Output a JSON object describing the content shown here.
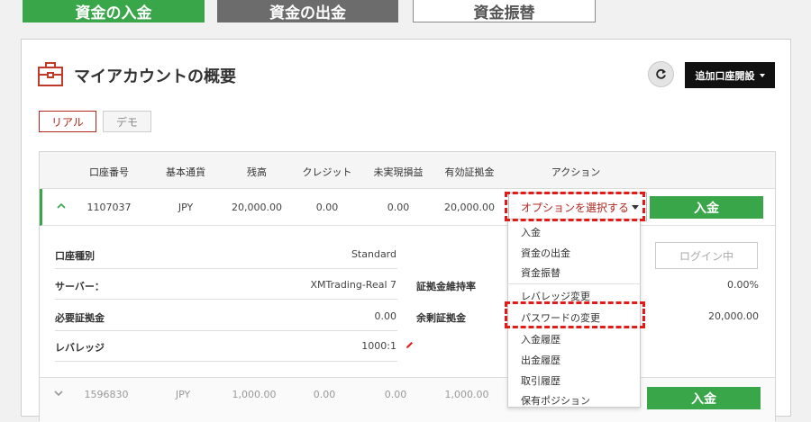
{
  "top_buttons": {
    "deposit": "資金の入金",
    "withdraw": "資金の出金",
    "transfer": "資金振替"
  },
  "header": {
    "title": "マイアカウントの概要",
    "add_account": "追加口座開設"
  },
  "tabs": {
    "real": "リアル",
    "demo": "デモ"
  },
  "table": {
    "columns": [
      "口座番号",
      "基本通貨",
      "残高",
      "クレジット",
      "未実現損益",
      "有効証拠金",
      "アクション"
    ],
    "row1": {
      "account": "1107037",
      "currency": "JPY",
      "balance": "20,000.00",
      "credit": "0.00",
      "unrealized": "0.00",
      "equity": "20,000.00",
      "select": "オプションを選択する",
      "deposit": "入金"
    },
    "row2": {
      "account": "1596830",
      "currency": "JPY",
      "balance": "1,000.00",
      "credit": "0.00",
      "unrealized": "0.00",
      "equity": "1,000.00",
      "deposit": "入金"
    }
  },
  "detail": {
    "type_label": "口座種別",
    "type_value": "Standard",
    "server_label": "サーバー：",
    "server_value": "XMTrading-Real 7",
    "margin_label": "必要証拠金",
    "margin_value": "0.00",
    "leverage_label": "レバレッジ",
    "leverage_value": "1000:1",
    "margin_level_label": "証拠金維持率",
    "margin_level_value": "0.00%",
    "free_margin_label": "余剰証拠金",
    "free_margin_value": "20,000.00",
    "login_button": "ログイン中"
  },
  "menu": {
    "items": [
      "入金",
      "資金の出金",
      "資金振替",
      "レバレッジ変更",
      "パスワードの変更",
      "入金履歴",
      "出金履歴",
      "取引履歴",
      "保有ポジション"
    ]
  },
  "colors": {
    "green": "#3aa64a",
    "red": "#b0261e",
    "highlight": "#e31a1a"
  }
}
